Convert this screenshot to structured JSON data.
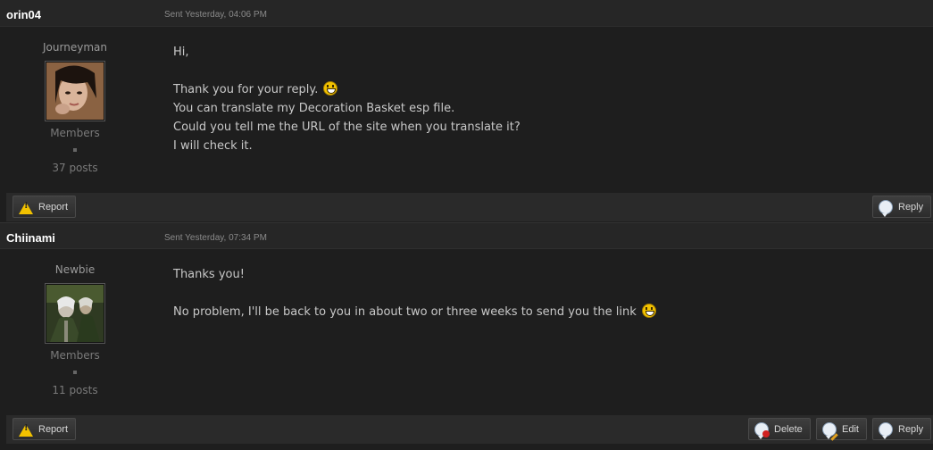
{
  "posts": [
    {
      "author": "orin04",
      "sent": "Sent Yesterday, 04:06 PM",
      "rank": "Journeyman",
      "group": "Members",
      "post_count": "37 posts",
      "lines": [
        "Hi,",
        "",
        "Thank you for your reply.",
        "You can translate my Decoration Basket esp file.",
        "Could you tell me the URL of the site when you translate it?",
        "I will check it."
      ],
      "buttons": {
        "report": "Report",
        "reply": "Reply"
      }
    },
    {
      "author": "Chiinami",
      "sent": "Sent Yesterday, 07:34 PM",
      "rank": "Newbie",
      "group": "Members",
      "post_count": "11 posts",
      "lines": [
        "Thanks you!",
        "",
        "No problem, I'll be back to you in about two or three weeks to send you the link"
      ],
      "buttons": {
        "report": "Report",
        "delete": "Delete",
        "edit": "Edit",
        "reply": "Reply"
      }
    }
  ],
  "icons": {
    "smiley": "smiley-icon",
    "report": "warning-icon",
    "reply": "speech-bubble-icon",
    "delete": "delete-bubble-icon",
    "edit": "edit-bubble-icon"
  },
  "colors": {
    "background": "#1e1e1e",
    "header": "#262626",
    "author": "#ffffff",
    "text": "#c8c8c8",
    "muted": "#7a7a7a"
  }
}
